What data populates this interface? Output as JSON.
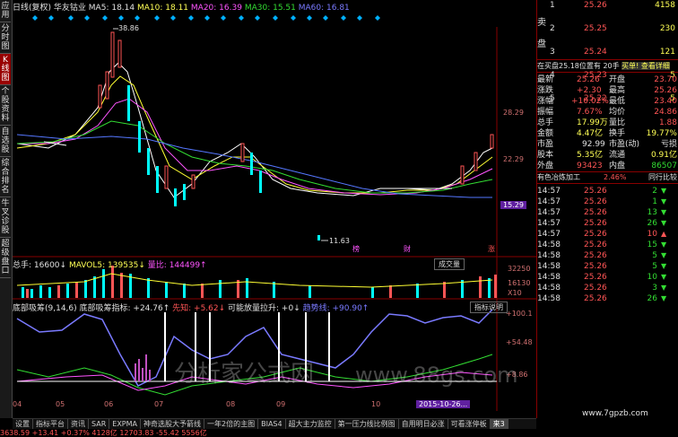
{
  "left_tabs": [
    "应用",
    "分时图",
    "K线图",
    "个股资料",
    "自选股",
    "综合排名",
    "牛叉诊股",
    "超级盘口"
  ],
  "left_tabs_active": 2,
  "header": {
    "period": "日线(复权)",
    "name": "华友钴业",
    "ma5": "MA5: 18.14",
    "ma10": "MA10: 18.11",
    "ma20": "MA20: 16.39",
    "ma30": "MA30: 15.51",
    "ma60": "MA60: 16.81"
  },
  "price_chart": {
    "high_label": "38.86",
    "low_label": "11.63",
    "axis": [
      "28.29",
      "22.29",
      "15.29"
    ],
    "events": [
      "榜",
      "财",
      "涨"
    ]
  },
  "volume": {
    "title": "总手: 16600↓",
    "mavol": "MAVOL5: 139535↓",
    "ratio": "量比: 144499↑",
    "button": "成交量",
    "axis": [
      "32250",
      "16130",
      "X10"
    ]
  },
  "indicator": {
    "title": "底部吸筹(9,14,6) 底部吸筹指标: +24.76↑",
    "xianzhi": "先知: +5.62↓",
    "kenengfang": "可能放量拉升: +0↓",
    "qushi": "趋势线: +90.90↑",
    "button": "指标说明",
    "axis": [
      "+100.1",
      "+54.48",
      "+8.86"
    ]
  },
  "x_axis": [
    "04",
    "05",
    "06",
    "07",
    "08",
    "09",
    "10"
  ],
  "date_badge": "2015-10-26...",
  "order_book": {
    "sell": [
      {
        "label": "卖",
        "lvl": "1",
        "price": "25.26",
        "vol": "4158"
      },
      {
        "label": "",
        "lvl": "2",
        "price": "25.25",
        "vol": "230"
      },
      {
        "label": "盘",
        "lvl": "3",
        "price": "25.24",
        "vol": "121"
      },
      {
        "label": "",
        "lvl": "4",
        "price": "25.23",
        "vol": "5"
      },
      {
        "label": "",
        "lvl": "5",
        "price": "25.22",
        "vol": "5"
      }
    ],
    "caption": "在买盘25.18位置有 20手",
    "caption_link": "买单! 查看详细"
  },
  "stats": [
    {
      "k": "最新",
      "v": "25.26",
      "k2": "开盘",
      "v2": "23.70"
    },
    {
      "k": "涨跌",
      "v": "+2.30",
      "k2": "最高",
      "v2": "25.26"
    },
    {
      "k": "涨幅",
      "v": "+10.02%",
      "k2": "最低",
      "v2": "23.40"
    },
    {
      "k": "振幅",
      "v": "7.67%",
      "k2": "均价",
      "v2": "24.86"
    },
    {
      "k": "总手",
      "v": "17.99万",
      "k2": "量比",
      "v2": "1.88"
    },
    {
      "k": "金额",
      "v": "4.47亿",
      "k2": "换手",
      "v2": "19.77%"
    },
    {
      "k": "市盈",
      "v": "92.99",
      "k2": "市盈(动)",
      "v2": "亏损"
    },
    {
      "k": "股本",
      "v": "5.35亿",
      "k2": "流通",
      "v2": "0.91亿"
    },
    {
      "k": "外盘",
      "v": "93423",
      "k2": "内盘",
      "v2": "86507"
    }
  ],
  "sector": {
    "name": "有色冶炼加工",
    "pct": "2.46%",
    "link": "同行比较"
  },
  "trades": [
    {
      "t": "14:57",
      "p": "25.26",
      "v": "2",
      "d": "down"
    },
    {
      "t": "14:57",
      "p": "25.26",
      "v": "1",
      "d": "down"
    },
    {
      "t": "14:57",
      "p": "25.26",
      "v": "13",
      "d": "down"
    },
    {
      "t": "14:57",
      "p": "25.26",
      "v": "26",
      "d": "down"
    },
    {
      "t": "14:57",
      "p": "25.26",
      "v": "10",
      "d": "up"
    },
    {
      "t": "14:58",
      "p": "25.26",
      "v": "15",
      "d": "down"
    },
    {
      "t": "14:58",
      "p": "25.26",
      "v": "5",
      "d": "down"
    },
    {
      "t": "14:58",
      "p": "25.26",
      "v": "5",
      "d": "down"
    },
    {
      "t": "14:58",
      "p": "25.26",
      "v": "10",
      "d": "down"
    },
    {
      "t": "14:58",
      "p": "25.26",
      "v": "3",
      "d": "down"
    },
    {
      "t": "14:58",
      "p": "25.26",
      "v": "26",
      "d": "down"
    }
  ],
  "bottom_tabs": [
    "设置",
    "指标平台",
    "资讯",
    "SAR",
    "EXPMA",
    "神奇选股大予箭线",
    "一年2倍的主图",
    "BIAS4",
    "超大主力监控",
    "第一压力线比例图",
    "自用明日必涨",
    "可看涨停板"
  ],
  "bottom_tabs_active_hint": "来3",
  "watermark_cn": "分析家公式网",
  "watermark_en": "www.88gs.com",
  "watermark_br": "www.7gpzb.com",
  "status_text": "3638.59  +13.41  +0.37%  4128亿  12703.83  -55.42  5556亿"
}
